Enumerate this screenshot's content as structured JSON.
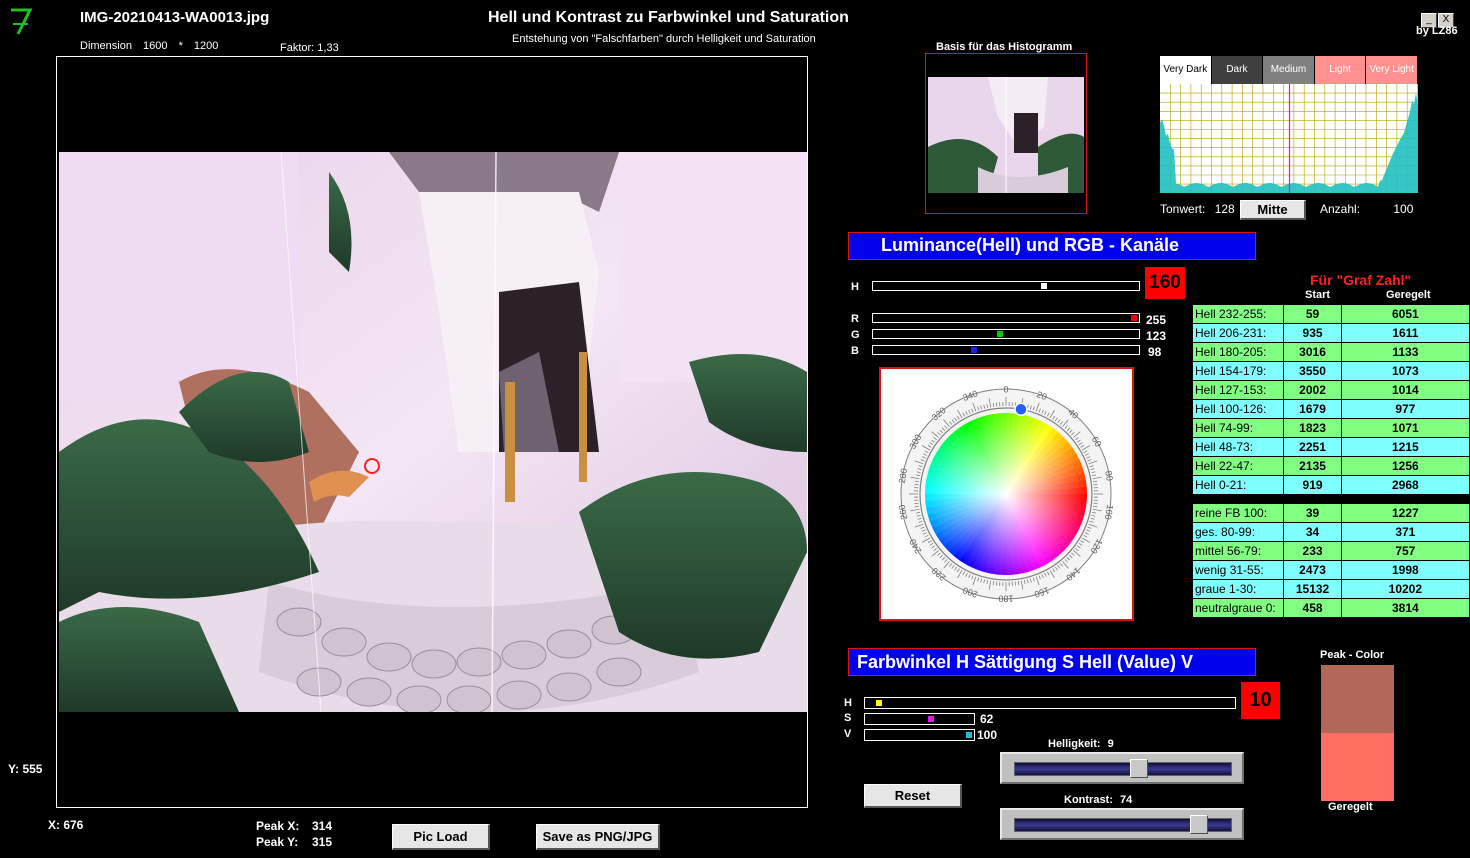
{
  "header": {
    "filename": "IMG-20210413-WA0013.jpg",
    "dimension_label": "Dimension",
    "width": "1600",
    "times": "*",
    "height": "1200",
    "faktor_label": "Faktor:",
    "faktor": "1,33",
    "title": "Hell und Kontrast zu Farbwinkel und Saturation",
    "subtitle": "Entstehung von \"Falschfarben\" durch Helligkeit und Saturation",
    "minimize": "_",
    "close": "X",
    "byline": "by LZ86"
  },
  "coords": {
    "y_label": "Y: 555",
    "x_label": "X: 676"
  },
  "peak": {
    "x_label": "Peak X:",
    "x": "314",
    "y_label": "Peak Y:",
    "y": "315"
  },
  "buttons": {
    "pic_load": "Pic Load",
    "save": "Save as PNG/JPG",
    "mitte": "Mitte",
    "reset": "Reset"
  },
  "histogram": {
    "basis_label": "Basis für das Histogramm",
    "bands": [
      "Very Dark",
      "Dark",
      "Medium",
      "Light",
      "Very Light"
    ],
    "band_colors": [
      "#ffffff",
      "#404040",
      "#808080",
      "#ff9090",
      "#ff9090"
    ],
    "band_text_colors": [
      "#000000",
      "#ffffff",
      "#ffffff",
      "#ffffff",
      "#ffffff"
    ],
    "tonwert_label": "Tonwert:",
    "tonwert": "128",
    "anzahl_label": "Anzahl:",
    "anzahl": "100",
    "marker_value": 128
  },
  "luminance": {
    "title": "Luminance(Hell) und RGB - Kanäle",
    "h_label": "H",
    "h_value": "160",
    "h_level": 0.65,
    "r_label": "R",
    "r_value": "255",
    "r_level": 1.0,
    "g_label": "G",
    "g_value": "123",
    "g_level": 0.48,
    "b_label": "B",
    "b_value": "98",
    "b_level": 0.38
  },
  "color_wheel": {
    "angles": [
      "0",
      "20",
      "40",
      "60",
      "80",
      "100",
      "120",
      "140",
      "160",
      "180",
      "200",
      "220",
      "240",
      "260",
      "280",
      "300",
      "320",
      "340"
    ],
    "marker_angle": 10
  },
  "graf_zahl": {
    "title": "Für \"Graf Zahl\"",
    "col_start": "Start",
    "col_geregelt": "Geregelt",
    "rows": [
      {
        "label": "Hell 232-255:",
        "start": "59",
        "geregelt": "6051",
        "c": "g"
      },
      {
        "label": "Hell 206-231:",
        "start": "935",
        "geregelt": "1611",
        "c": "c"
      },
      {
        "label": "Hell 180-205:",
        "start": "3016",
        "geregelt": "1133",
        "c": "g"
      },
      {
        "label": "Hell 154-179:",
        "start": "3550",
        "geregelt": "1073",
        "c": "c"
      },
      {
        "label": "Hell 127-153:",
        "start": "2002",
        "geregelt": "1014",
        "c": "g"
      },
      {
        "label": "Hell 100-126:",
        "start": "1679",
        "geregelt": "977",
        "c": "c"
      },
      {
        "label": "Hell 74-99:",
        "start": "1823",
        "geregelt": "1071",
        "c": "g"
      },
      {
        "label": "Hell 48-73:",
        "start": "2251",
        "geregelt": "1215",
        "c": "c"
      },
      {
        "label": "Hell 22-47:",
        "start": "2135",
        "geregelt": "1256",
        "c": "g"
      },
      {
        "label": "Hell 0-21:",
        "start": "919",
        "geregelt": "2968",
        "c": "c"
      }
    ],
    "rows2": [
      {
        "label": "reine FB 100:",
        "start": "39",
        "geregelt": "1227",
        "c": "g"
      },
      {
        "label": "ges. 80-99:",
        "start": "34",
        "geregelt": "371",
        "c": "c"
      },
      {
        "label": "mittel 56-79:",
        "start": "233",
        "geregelt": "757",
        "c": "g"
      },
      {
        "label": "wenig 31-55:",
        "start": "2473",
        "geregelt": "1998",
        "c": "c"
      },
      {
        "label": "graue  1-30:",
        "start": "15132",
        "geregelt": "10202",
        "c": "c"
      },
      {
        "label": "neutralgraue 0:",
        "start": "458",
        "geregelt": "3814",
        "c": "g"
      }
    ]
  },
  "hsv": {
    "title": "Farbwinkel H   Sättigung S   Hell (Value) V",
    "h_label": "H",
    "h_value": "10",
    "h_level": 0.03,
    "s_label": "S",
    "s_value": "62",
    "s_level": 0.62,
    "v_label": "V",
    "v_value": "100",
    "v_level": 1.0
  },
  "helligkeit": {
    "label": "Helligkeit:",
    "value": "9",
    "level": 0.58
  },
  "kontrast": {
    "label": "Kontrast:",
    "value": "74",
    "level": 0.88
  },
  "peak_color": {
    "label": "Peak - Color",
    "geregelt_label": "Geregelt",
    "start_color": "#b06858",
    "geregelt_color": "#ff7060"
  }
}
